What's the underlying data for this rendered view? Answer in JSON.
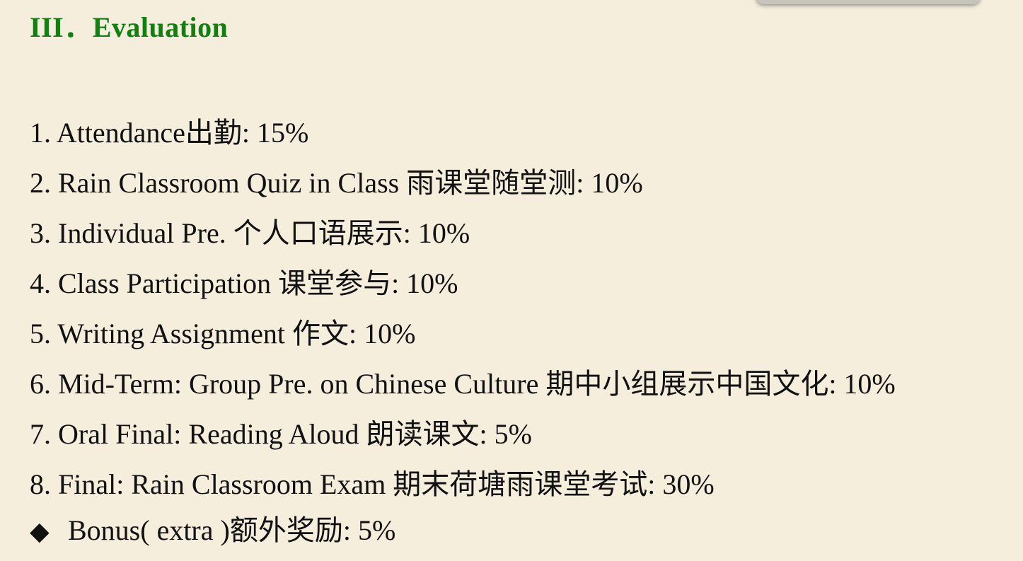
{
  "heading": "III．Evaluation",
  "items": [
    "1. Attendance出勤: 15%",
    "2. Rain Classroom Quiz in Class 雨课堂随堂测: 10%",
    "3. Individual Pre. 个人口语展示: 10%",
    "4. Class Participation 课堂参与: 10%",
    "5. Writing Assignment 作文: 10%",
    "6. Mid-Term: Group Pre. on Chinese Culture 期中小组展示中国文化: 10%",
    "7. Oral Final: Reading Aloud 朗读课文: 5%",
    "8. Final: Rain Classroom Exam 期末荷塘雨课堂考试: 30%"
  ],
  "bonus": {
    "bullet": "◆",
    "text": "Bonus( extra )额外奖励: 5%"
  }
}
